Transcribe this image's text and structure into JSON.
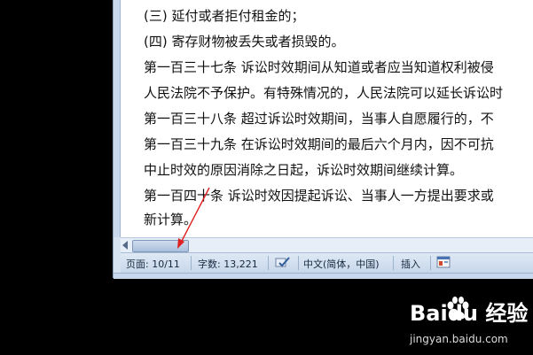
{
  "document": {
    "lines": [
      "(三) 延付或者拒付租金的；",
      "(四) 寄存财物被丢失或者损毁的。",
      "第一百三十七条  诉讼时效期间从知道或者应当知道权利被侵",
      "人民法院不予保护。有特殊情况的，人民法院可以延长诉讼时",
      "第一百三十八条  超过诉讼时效期间，当事人自愿履行的，不",
      "第一百三十九条  在诉讼时效期间的最后六个月内，因不可抗",
      "中止时效的原因消除之日起，诉讼时效期间继续计算。",
      "第一百四十条  诉讼时效因提起诉讼、当事人一方提出要求或",
      "新计算。"
    ]
  },
  "status_bar": {
    "page": "页面: 10/11",
    "word_count": "字数: 13,221",
    "language": "中文(简体，中国)",
    "mode": "插入"
  },
  "watermark": {
    "brand": "Baidu 经验",
    "url": "jingyan.baidu.com"
  },
  "colors": {
    "annotation_arrow": "#e02020"
  }
}
